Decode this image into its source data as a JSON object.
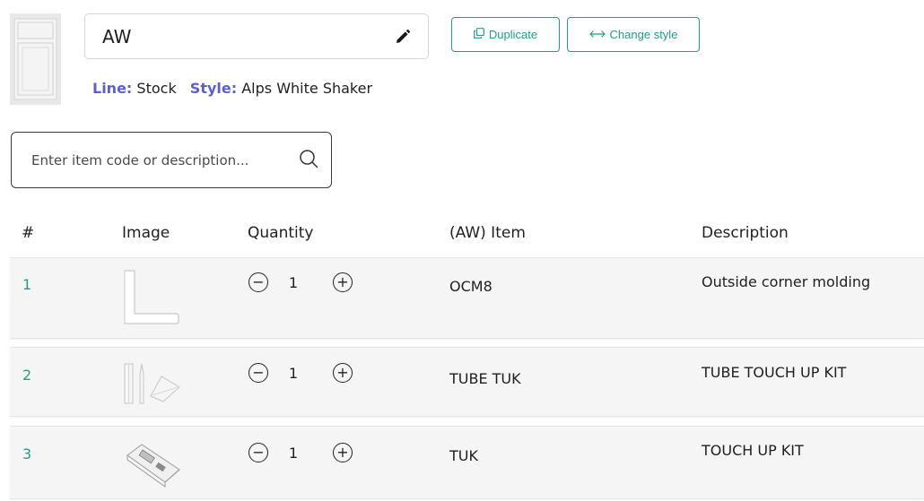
{
  "header": {
    "name": "AW",
    "duplicate_label": "Duplicate",
    "change_style_label": "Change style",
    "line_label": "Line:",
    "line_value": "Stock",
    "style_label": "Style:",
    "style_value": "Alps White Shaker"
  },
  "search": {
    "placeholder": "Enter item code or description..."
  },
  "table": {
    "columns": [
      "#",
      "Image",
      "Quantity",
      "(AW) Item",
      "Description"
    ],
    "rows": [
      {
        "num": "1",
        "quantity": "1",
        "code": "OCM8",
        "description": "Outside corner molding",
        "image": "corner-molding-image"
      },
      {
        "num": "2",
        "quantity": "1",
        "code": "TUBE TUK",
        "description": "TUBE TOUCH UP KIT",
        "image": "tube-kit-image"
      },
      {
        "num": "3",
        "quantity": "1",
        "code": "TUK",
        "description": "TOUCH UP KIT",
        "image": "touch-up-kit-image"
      }
    ]
  },
  "colors": {
    "accent": "#1f9e88",
    "label": "#5a5fd6"
  }
}
